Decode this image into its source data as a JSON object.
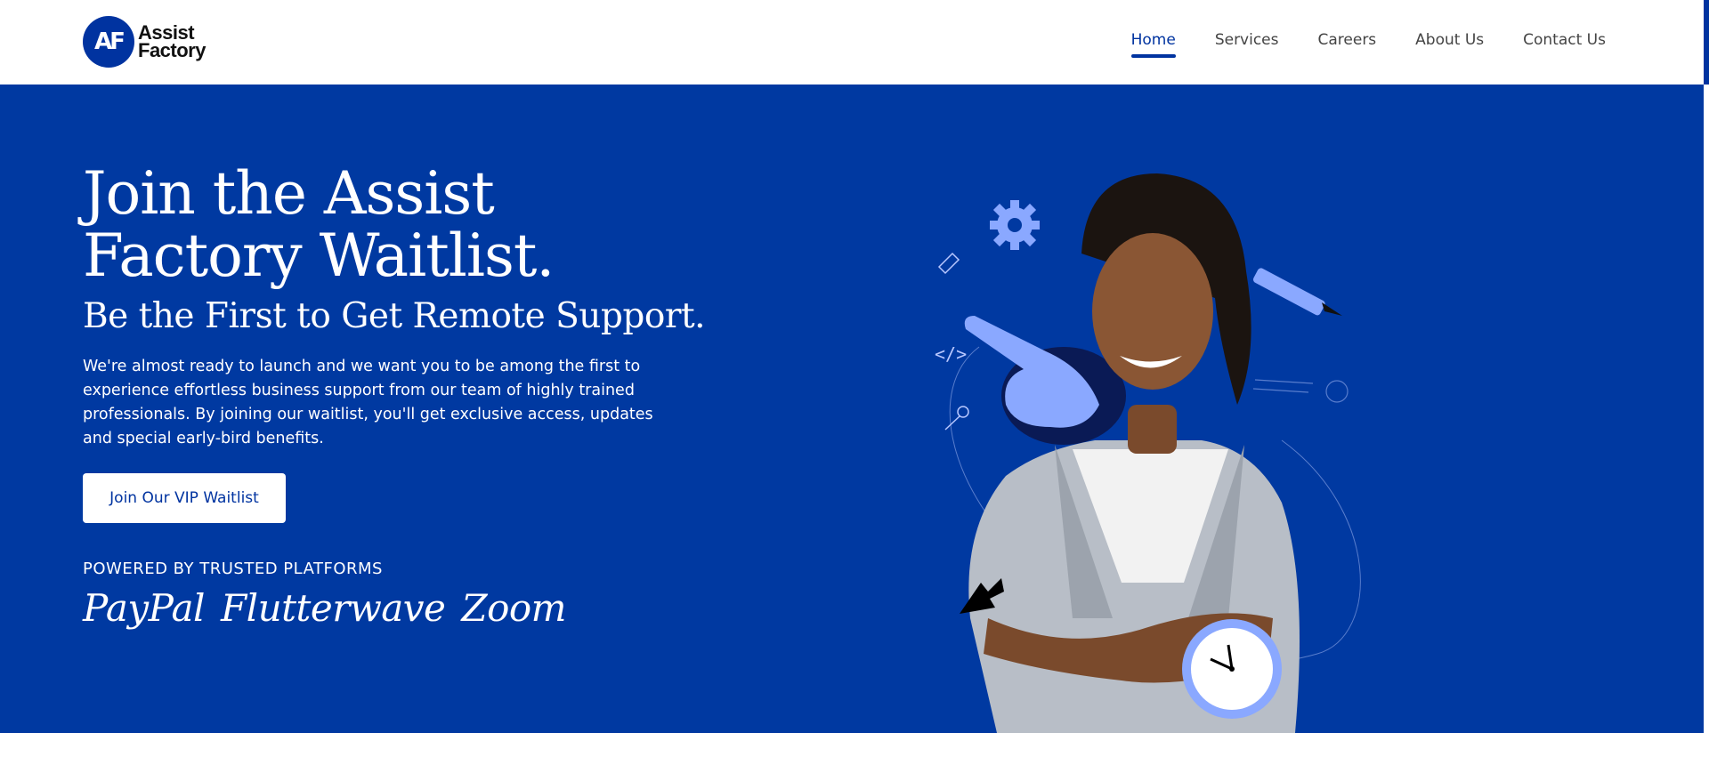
{
  "brand": {
    "mark": "AF",
    "name_line1": "Assist",
    "name_line2": "Factory"
  },
  "nav": {
    "items": [
      {
        "label": "Home",
        "active": true
      },
      {
        "label": "Services",
        "active": false
      },
      {
        "label": "Careers",
        "active": false
      },
      {
        "label": "About Us",
        "active": false
      },
      {
        "label": "Contact Us",
        "active": false
      }
    ]
  },
  "hero": {
    "title": "Join the Assist Factory Waitlist.",
    "subtitle": "Be the First to Get Remote Support.",
    "description": "We're almost ready to launch and we want you to be among the first to experience effortless business support from our team of highly trained professionals. By joining our waitlist, you'll get exclusive access, updates and special early-bird benefits.",
    "cta_label": "Join Our VIP Waitlist",
    "powered_label": "POWERED BY TRUSTED PLATFORMS",
    "platforms": [
      "PayPal",
      "Flutterwave",
      "Zoom"
    ]
  },
  "illustration": {
    "subject": "smiling-woman-arms-crossed",
    "icons": [
      "gear-icon",
      "pencil-icon",
      "code-icon",
      "key-icon",
      "pointing-hand-icon",
      "marker-icon",
      "cursor-icon",
      "clock-icon"
    ]
  },
  "colors": {
    "primary": "#0039a1",
    "accent_light": "#8aa8ff",
    "white": "#ffffff",
    "nav_text": "#444444"
  }
}
